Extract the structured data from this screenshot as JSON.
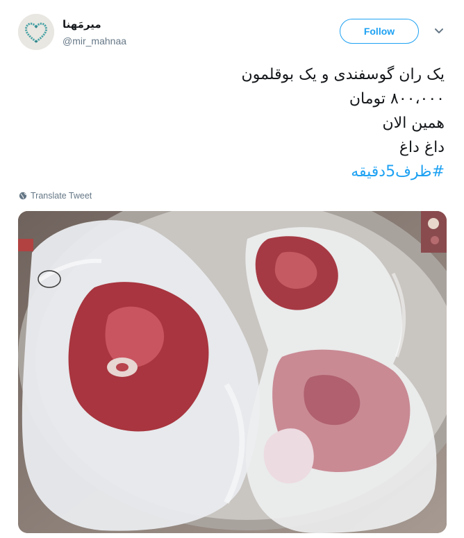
{
  "user": {
    "display_name": "میرمَهنا",
    "handle": "@mir_mahnaa",
    "avatar_icon": "heart-beads-avatar"
  },
  "actions": {
    "follow_label": "Follow",
    "menu_icon": "chevron-down-icon"
  },
  "tweet": {
    "lines": [
      "یک ران گوسفندی و یک بوقلمون",
      "۸۰۰،۰۰۰ تومان",
      "همین الان",
      "داغ داغ"
    ],
    "hashtag": "#ظرف5دقیقه"
  },
  "translate_label": "Translate Tweet",
  "colors": {
    "accent": "#1da1f2",
    "secondary_text": "#657786",
    "primary_text": "#14171a"
  },
  "media": {
    "type": "photo",
    "icon": "photo-meat-in-plastic-bags"
  }
}
